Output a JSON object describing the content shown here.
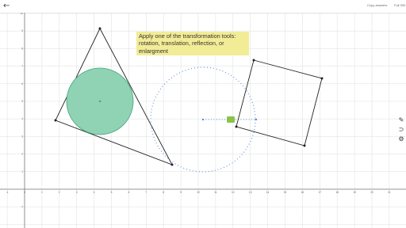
{
  "topbar": {
    "back_icon": "arrow-left-icon",
    "left_button": "Copy answers",
    "right_button": "Full 300"
  },
  "instruction": {
    "text": "Apply one of the transformation tools: rotation, translation, reflection, or enlargment"
  },
  "axes": {
    "x_ticks": [
      "-1",
      "0",
      "1",
      "2",
      "3",
      "4",
      "5",
      "6",
      "7",
      "8",
      "9",
      "10",
      "11",
      "12",
      "13",
      "14",
      "15",
      "16",
      "17",
      "18",
      "19",
      "20",
      "21",
      "22"
    ],
    "y_ticks": [
      "10",
      "9",
      "8",
      "7",
      "6",
      "5",
      "4",
      "3",
      "2",
      "1",
      "-1"
    ]
  },
  "side_tools": [
    {
      "icon": "pencil-icon"
    },
    {
      "icon": "magnet-icon"
    },
    {
      "icon": "gear-icon"
    }
  ],
  "colors": {
    "circle_fill": "#8fd3b4",
    "circle_stroke": "#43a37c",
    "accent": "#4a7fd4",
    "handle": "#8bc34a"
  }
}
